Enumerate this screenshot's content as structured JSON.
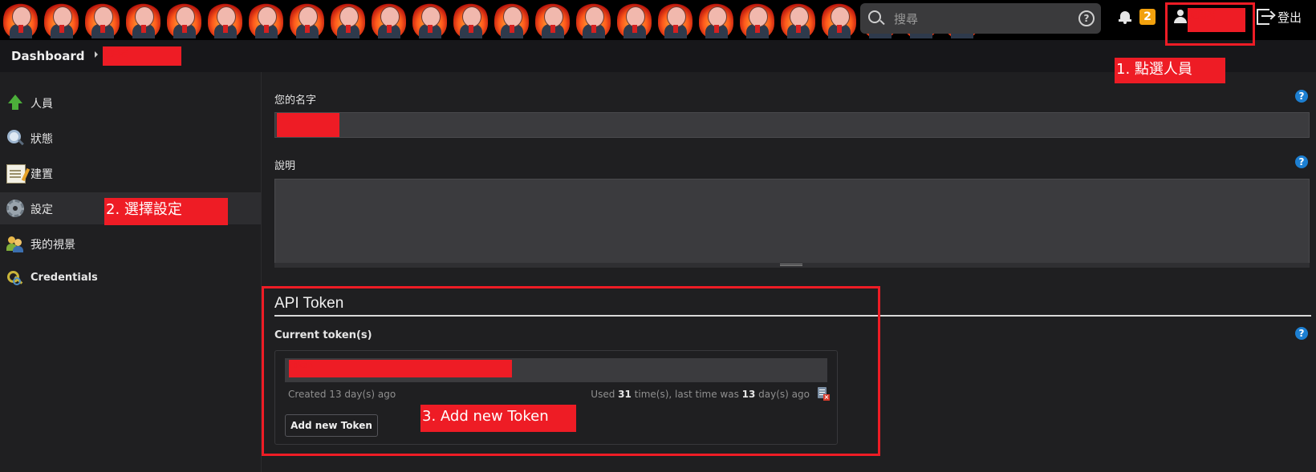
{
  "header": {
    "logo_count": 24,
    "search_placeholder": "搜尋",
    "notification_count": "2",
    "user_name_redacted": "使用者",
    "logout_label": "登出"
  },
  "breadcrumb": {
    "dashboard": "Dashboard",
    "user_redacted": "使用者"
  },
  "sidebar": {
    "items": [
      {
        "label": "人員",
        "icon": "arrow-up-icon"
      },
      {
        "label": "狀態",
        "icon": "magnifier-icon"
      },
      {
        "label": "建置",
        "icon": "notepad-icon"
      },
      {
        "label": "設定",
        "icon": "gear-icon",
        "active": true
      },
      {
        "label": "我的視景",
        "icon": "people-icon"
      },
      {
        "label": "Credentials",
        "icon": "keys-icon"
      }
    ]
  },
  "form": {
    "name_label": "您的名字",
    "name_value_redacted": "名字",
    "description_label": "說明",
    "help_glyph": "?"
  },
  "api_token": {
    "title": "API Token",
    "current_tokens_label": "Current token(s)",
    "token_value_redacted": "token",
    "created_text": "Created 13 day(s) ago",
    "used_prefix": "Used ",
    "used_count": "31",
    "used_middle": " time(s), last time was ",
    "last_used_days": "13",
    "used_suffix": " day(s) ago",
    "add_button": "Add new Token"
  },
  "annotations": {
    "step1": "1. 點選人員",
    "step2": "2. 選擇設定",
    "step3": "3. Add new Token",
    "color": "#ee1c25"
  },
  "colors": {
    "accent_red": "#ee1c25",
    "help_blue": "#1d7fd1",
    "badge_orange": "#f2a10d",
    "background": "#1f1f21"
  }
}
